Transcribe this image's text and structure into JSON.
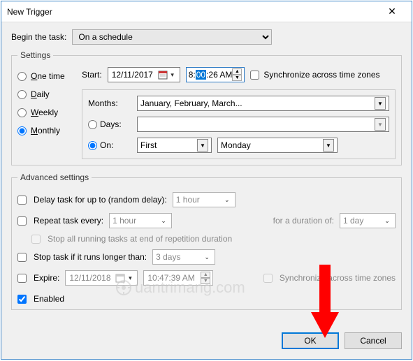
{
  "window": {
    "title": "New Trigger"
  },
  "begin": {
    "label": "Begin the task:",
    "value": "On a schedule",
    "options": [
      "On a schedule"
    ]
  },
  "settings": {
    "legend": "Settings",
    "schedule_radios": {
      "one_time": "One time",
      "daily": "Daily",
      "weekly": "Weekly",
      "monthly": "Monthly",
      "selected": "monthly"
    },
    "start_label": "Start:",
    "start_date": "12/11/2017",
    "start_time_pre": "8:",
    "start_time_sel": "00",
    "start_time_post": ":26 AM",
    "sync_tz_label": "Synchronize across time zones",
    "months_label": "Months:",
    "months_value": "January, February, March...",
    "days_label": "Days:",
    "days_value": "",
    "on_label": "On:",
    "on_ordinal": "First",
    "on_day": "Monday",
    "days_on_selected": "on"
  },
  "advanced": {
    "legend": "Advanced settings",
    "delay_label": "Delay task for up to (random delay):",
    "delay_value": "1 hour",
    "repeat_label": "Repeat task every:",
    "repeat_value": "1 hour",
    "duration_label": "for a duration of:",
    "duration_value": "1 day",
    "stop_running_label": "Stop all running tasks at end of repetition duration",
    "stop_longer_label": "Stop task if it runs longer than:",
    "stop_longer_value": "3 days",
    "expire_label": "Expire:",
    "expire_date": "12/11/2018",
    "expire_time": "10:47:39 AM",
    "sync_tz2_label": "Synchronize across time zones",
    "enabled_label": "Enabled"
  },
  "footer": {
    "ok": "OK",
    "cancel": "Cancel"
  },
  "watermark": "uantrimang.com"
}
